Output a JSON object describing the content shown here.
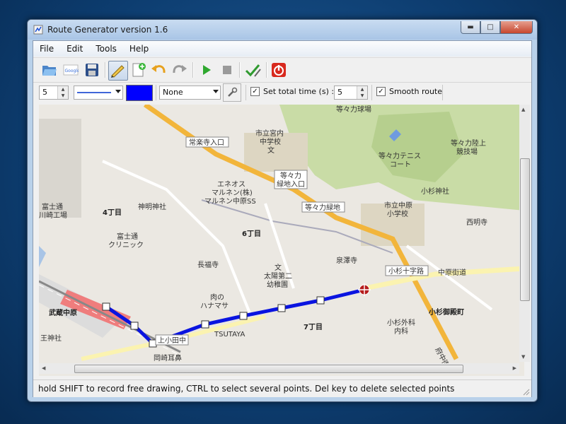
{
  "window": {
    "title": "Route Generator version 1.6"
  },
  "menus": [
    "File",
    "Edit",
    "Tools",
    "Help"
  ],
  "options": {
    "line_width": "5",
    "line_style": "",
    "line_color": "#0000ff",
    "marker": "None",
    "set_total_time_label": "Set total time (s) :",
    "total_time": "5",
    "smooth_route_label": "Smooth route"
  },
  "map": {
    "labels": [
      "等々力球場",
      "常楽寺入口",
      "市立宮内",
      "中学校",
      "文",
      "等々力",
      "緑地入口",
      "等々力テニス",
      "コート",
      "等々力陸上",
      "競技場",
      "エネオス",
      "マルネン(株)",
      "マルネン中原SS",
      "小杉神社",
      "富士通",
      "川崎工場",
      "神明神社",
      "4丁目",
      "等々力緑地",
      "市立中原",
      "小学校",
      "西明寺",
      "6丁目",
      "富士通",
      "クリニック",
      "長福寺",
      "泉澤寺",
      "文",
      "太陽第二",
      "幼稚園",
      "小杉十字路",
      "中原街道",
      "肉の",
      "ハナマサ",
      "武蔵中原",
      "小杉御殿町",
      "TSUTAYA",
      "7丁目",
      "小杉外科",
      "内科",
      "上小田中",
      "岡崎耳鼻",
      "王神社",
      "府中街道"
    ]
  },
  "status": {
    "text": "hold SHIFT to record free drawing, CTRL to select several points. Del key to delete selected points"
  }
}
